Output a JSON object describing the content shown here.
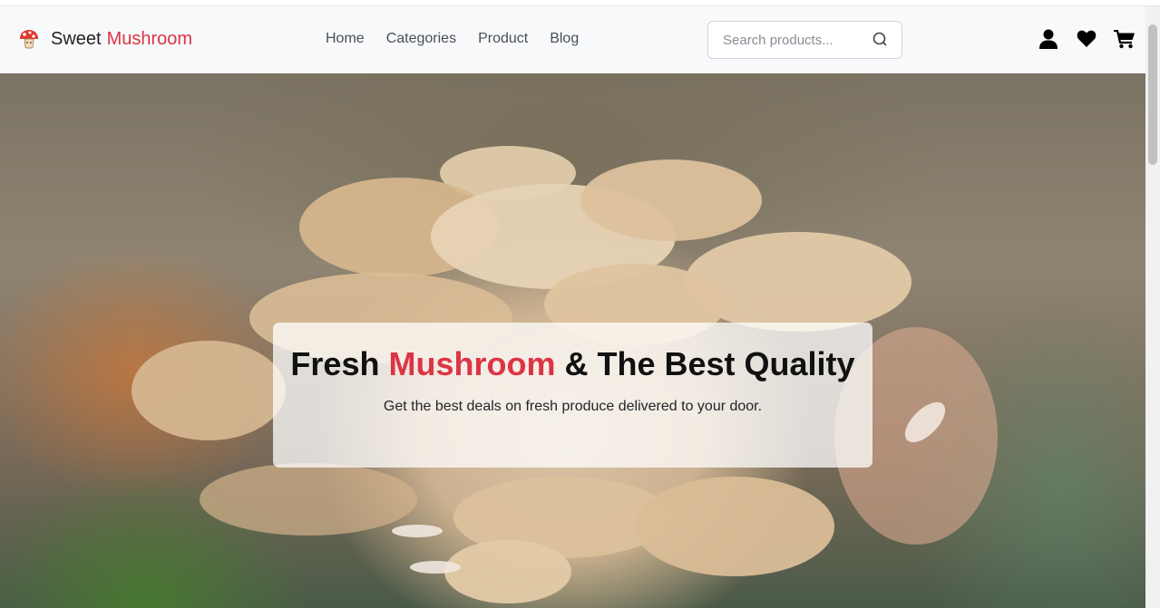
{
  "brand": {
    "name_part1": "Sweet",
    "name_part2": "Mushroom",
    "logo_icon": "mushroom-icon"
  },
  "nav": {
    "links": [
      {
        "label": "Home"
      },
      {
        "label": "Categories"
      },
      {
        "label": "Product"
      },
      {
        "label": "Blog"
      }
    ]
  },
  "search": {
    "placeholder": "Search products...",
    "value": "",
    "icon": "search-icon"
  },
  "header_icons": [
    {
      "name": "user-icon"
    },
    {
      "name": "heart-icon"
    },
    {
      "name": "cart-icon"
    }
  ],
  "hero": {
    "title_part1": "Fresh",
    "title_accent": "Mushroom",
    "title_part2": "& The Best Quality",
    "subtitle": "Get the best deals on fresh produce delivered to your door."
  },
  "colors": {
    "accent": "#dc3545",
    "navbar_bg": "#f8f9fa"
  }
}
